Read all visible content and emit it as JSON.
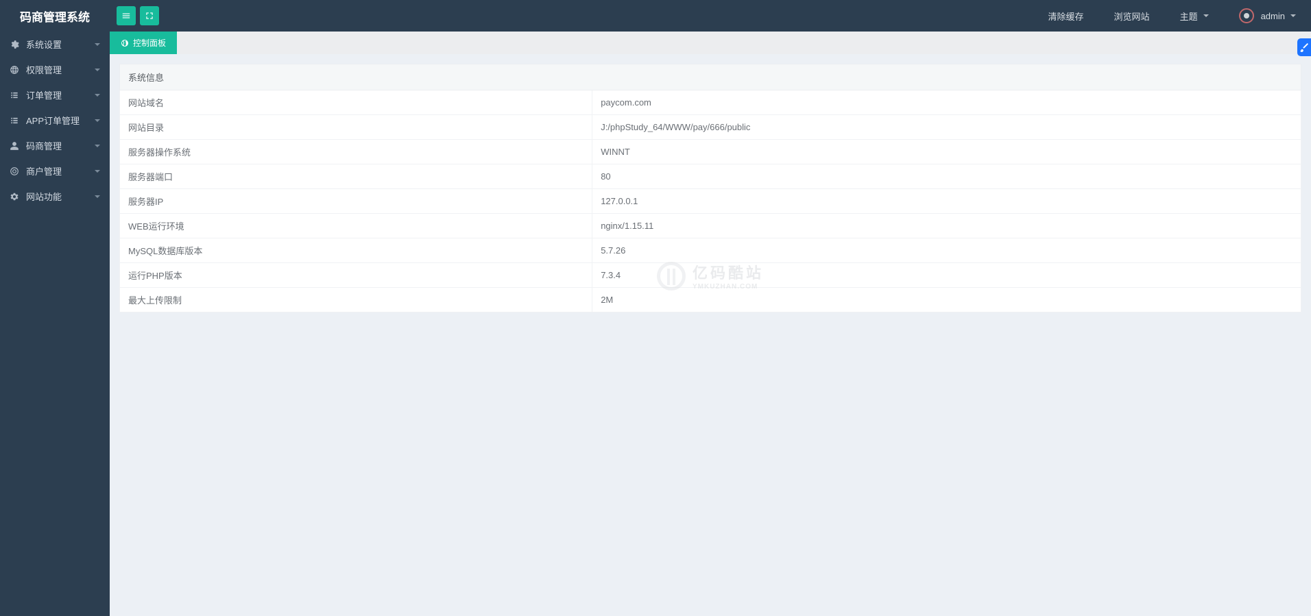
{
  "app_title": "码商管理系统",
  "topbar": {
    "clear_cache": "清除缓存",
    "visit_site": "浏览网站",
    "theme": "主题",
    "user": "admin"
  },
  "sidebar": {
    "items": [
      {
        "label": "系统设置",
        "icon": "gear"
      },
      {
        "label": "权限管理",
        "icon": "globe"
      },
      {
        "label": "订单管理",
        "icon": "list"
      },
      {
        "label": "APP订单管理",
        "icon": "list"
      },
      {
        "label": "码商管理",
        "icon": "user"
      },
      {
        "label": "商户管理",
        "icon": "target"
      },
      {
        "label": "网站功能",
        "icon": "cog"
      }
    ]
  },
  "tab": {
    "label": "控制面板"
  },
  "sysinfo": {
    "header": "系统信息",
    "rows": [
      {
        "key": "网站域名",
        "value": "paycom.com"
      },
      {
        "key": "网站目录",
        "value": "J:/phpStudy_64/WWW/pay/666/public"
      },
      {
        "key": "服务器操作系统",
        "value": "WINNT"
      },
      {
        "key": "服务器端口",
        "value": "80"
      },
      {
        "key": "服务器IP",
        "value": "127.0.0.1"
      },
      {
        "key": "WEB运行环境",
        "value": "nginx/1.15.11"
      },
      {
        "key": "MySQL数据库版本",
        "value": "5.7.26"
      },
      {
        "key": "运行PHP版本",
        "value": "7.3.4"
      },
      {
        "key": "最大上传限制",
        "value": "2M"
      }
    ]
  },
  "watermark": {
    "cn": "亿码酷站",
    "en": "YMKUZHAN.COM"
  }
}
